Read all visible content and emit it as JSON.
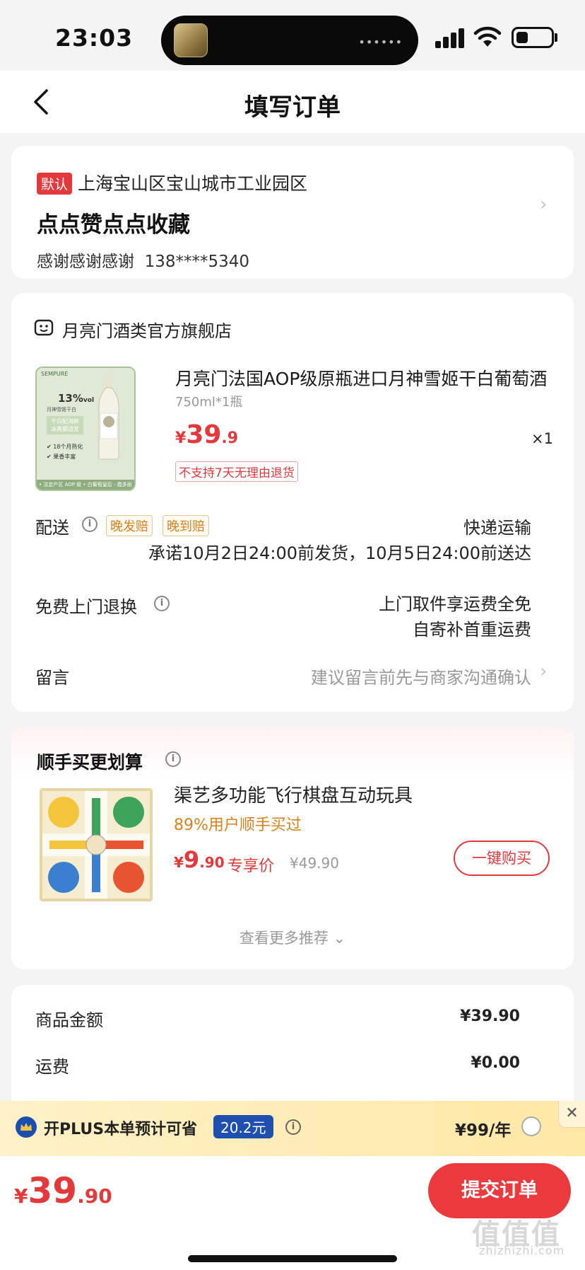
{
  "status": {
    "time": "23:03"
  },
  "nav": {
    "title": "填写订单"
  },
  "address": {
    "tag": "默认",
    "region": "上海宝山区宝山城市工业园区",
    "detail": "点点赞点点收藏",
    "name": "感谢感谢感谢",
    "phone": "138****5340"
  },
  "shop": {
    "name": "月亮门酒类官方旗舰店"
  },
  "product": {
    "title": "月亮门法国AOP级原瓶进口月神雪姬干白葡萄酒",
    "spec": "750ml*1瓶",
    "currency": "¥",
    "price_int": "39",
    "price_dec": ".9",
    "qty": "×1",
    "notice": "不支持7天无理由退货",
    "image_text": {
      "brand": "SEMPURE",
      "abv": "13%",
      "abv_unit": "vol",
      "sub": "月神雪姬干白",
      "slogan1": "干白配海鲜",
      "slogan2": "冰爽都适宜",
      "feat1": "18个月熟化",
      "feat2": "果香丰富",
      "footer": "• 法定产区 AOP 级 • 白葡萄皇后 - 霞多丽"
    }
  },
  "delivery": {
    "label": "配送",
    "tag1": "晚发赔",
    "tag2": "晚到赔",
    "method": "快递运输",
    "promise": "承诺10月2日24:00前发货，10月5日24:00前送达"
  },
  "returns": {
    "label": "免费上门退换",
    "line1": "上门取件享运费全免",
    "line2": "自寄补首重运费"
  },
  "message": {
    "label": "留言",
    "placeholder": "建议留言前先与商家沟通确认"
  },
  "recommend": {
    "title": "顺手买更划算",
    "name": "渠艺多功能飞行棋盘互动玩具",
    "rate": "89%用户顺手买过",
    "currency": "¥",
    "price_int": "9",
    "price_dec": ".90",
    "exclusive": "专享价",
    "original": "¥49.90",
    "buy": "一键购买",
    "more": "查看更多推荐"
  },
  "summary": {
    "goods_label": "商品金额",
    "goods_value": "¥39.90",
    "freight_label": "运费",
    "freight_value": "¥0.00"
  },
  "plus": {
    "text": "开PLUS本单预计可省",
    "save": "20.2元",
    "price": "¥99/年"
  },
  "footer": {
    "currency": "¥",
    "total_int": "39",
    "total_dec": ".90",
    "submit": "提交订单"
  },
  "watermark": {
    "main": "值值值",
    "sub": "zhizhizhi.com"
  },
  "colors": {
    "accent": "#e4393c",
    "plus_blue": "#1f4fae",
    "tag_orange": "#d9821c"
  }
}
